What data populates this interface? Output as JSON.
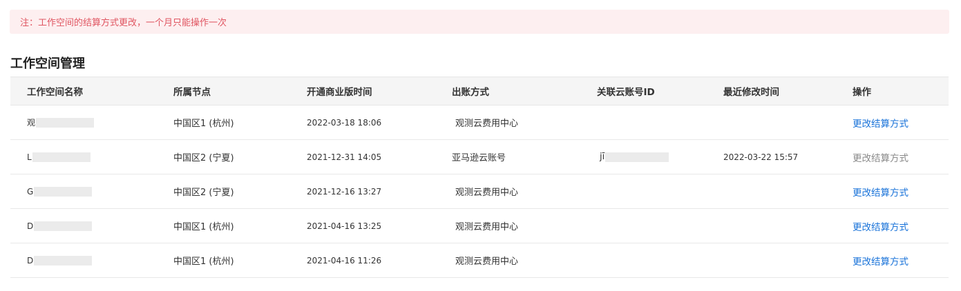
{
  "notice": {
    "text": "注：工作空间的结算方式更改，一个月只能操作一次"
  },
  "section": {
    "title": "工作空间管理"
  },
  "table": {
    "columns": [
      "工作空间名称",
      "所属节点",
      "开通商业版时间",
      "出账方式",
      "关联云账号ID",
      "最近修改时间",
      "操作"
    ],
    "rows": [
      {
        "name": "观",
        "node": "中国区1 (杭州)",
        "time": "2022-03-18 18:06",
        "billing": "观测云费用中心",
        "account": "",
        "modified": "",
        "action": "更改结算方式",
        "action_enabled": true
      },
      {
        "name": "L",
        "node": "中国区2 (宁夏)",
        "time": "2021-12-31 14:05",
        "billing": "亚马逊云账号",
        "account": "jī",
        "modified": "2022-03-22 15:57",
        "action": "更改结算方式",
        "action_enabled": false
      },
      {
        "name": "G",
        "node": "中国区2 (宁夏)",
        "time": "2021-12-16 13:27",
        "billing": "观测云费用中心",
        "account": "",
        "modified": "",
        "action": "更改结算方式",
        "action_enabled": true
      },
      {
        "name": "D",
        "node": "中国区1 (杭州)",
        "time": "2021-04-16 13:25",
        "billing": "观测云费用中心",
        "account": "",
        "modified": "",
        "action": "更改结算方式",
        "action_enabled": true
      },
      {
        "name": "D",
        "node": "中国区1 (杭州)",
        "time": "2021-04-16 11:26",
        "billing": "观测云费用中心",
        "account": "",
        "modified": "",
        "action": "更改结算方式",
        "action_enabled": true
      }
    ]
  },
  "colors": {
    "notice_bg": "#fdeff0",
    "notice_text": "#e05561",
    "link": "#1a73d9",
    "disabled_link": "#8a8a8a",
    "header_bg": "#f5f5f5"
  }
}
